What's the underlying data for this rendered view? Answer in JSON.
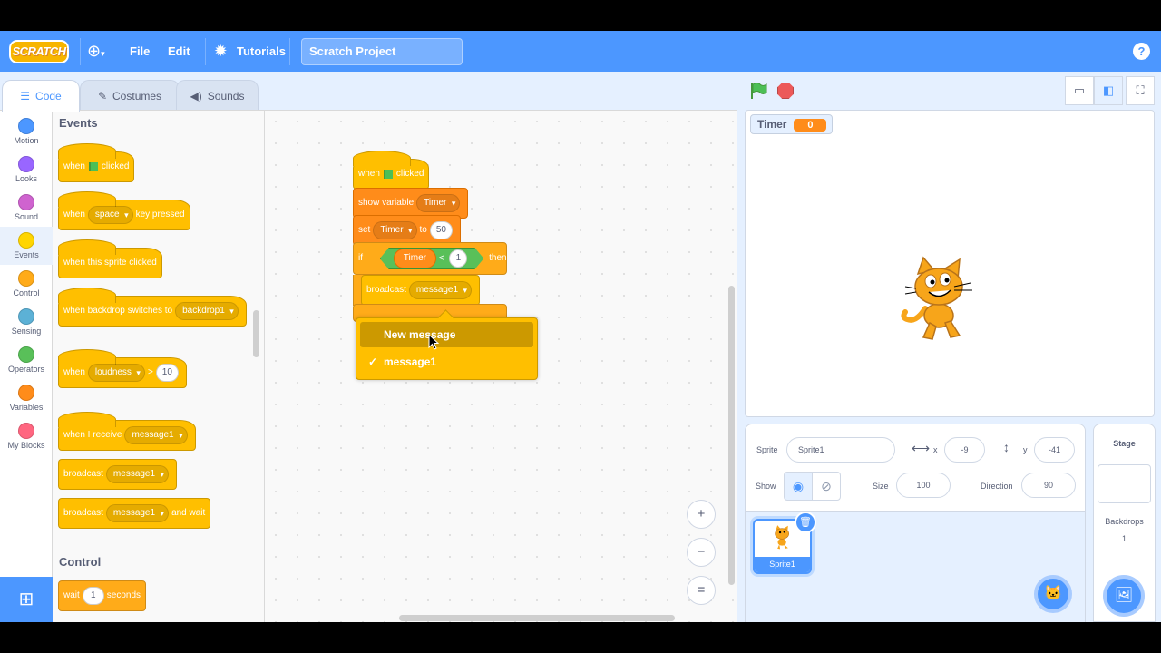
{
  "menubar": {
    "logo": "SCRATCH",
    "file": "File",
    "edit": "Edit",
    "tutorials": "Tutorials",
    "project_title": "Scratch Project",
    "help": "?"
  },
  "tabs": [
    {
      "label": "Code",
      "icon": "code-icon"
    },
    {
      "label": "Costumes",
      "icon": "brush-icon"
    },
    {
      "label": "Sounds",
      "icon": "speaker-icon"
    }
  ],
  "categories": [
    {
      "label": "Motion",
      "color": "#4c97ff"
    },
    {
      "label": "Looks",
      "color": "#9966ff"
    },
    {
      "label": "Sound",
      "color": "#cf63cf"
    },
    {
      "label": "Events",
      "color": "#ffd500"
    },
    {
      "label": "Control",
      "color": "#ffab19"
    },
    {
      "label": "Sensing",
      "color": "#5cb1d6"
    },
    {
      "label": "Operators",
      "color": "#59c059"
    },
    {
      "label": "Variables",
      "color": "#ff8c1a"
    },
    {
      "label": "My Blocks",
      "color": "#ff6680"
    }
  ],
  "palette": {
    "events_heading": "Events",
    "control_heading": "Control",
    "when": "when",
    "clicked": "clicked",
    "space": "space",
    "key_pressed": "key pressed",
    "when_sprite_clicked": "when this sprite clicked",
    "when_backdrop_switches": "when backdrop switches to",
    "backdrop1": "backdrop1",
    "loudness": "loudness",
    "gt": ">",
    "ten": "10",
    "when_i_receive": "when I receive",
    "message1": "message1",
    "broadcast": "broadcast",
    "and_wait": "and wait",
    "wait": "wait",
    "one": "1",
    "seconds": "seconds"
  },
  "script": {
    "when": "when",
    "clicked": "clicked",
    "show_variable": "show variable",
    "timer": "Timer",
    "set": "set",
    "to": "to",
    "fifty": "50",
    "if": "if",
    "lt": "<",
    "one": "1",
    "then": "then",
    "broadcast": "broadcast",
    "message1": "message1"
  },
  "dropdown": {
    "items": [
      {
        "label": "New message",
        "checked": false
      },
      {
        "label": "message1",
        "checked": true
      }
    ],
    "check": "✓"
  },
  "zoom": {
    "in": "+",
    "out": "−",
    "reset": "="
  },
  "stage": {
    "monitor_label": "Timer",
    "monitor_value": "0"
  },
  "sprite_info": {
    "sprite_label": "Sprite",
    "sprite_name": "Sprite1",
    "x_label": "x",
    "x_value": "-9",
    "y_label": "y",
    "y_value": "-41",
    "show_label": "Show",
    "size_label": "Size",
    "size_value": "100",
    "direction_label": "Direction",
    "direction_value": "90"
  },
  "sprite_list": [
    {
      "name": "Sprite1"
    }
  ],
  "stage_pane": {
    "title": "Stage",
    "backdrops_label": "Backdrops",
    "backdrops_count": "1"
  }
}
